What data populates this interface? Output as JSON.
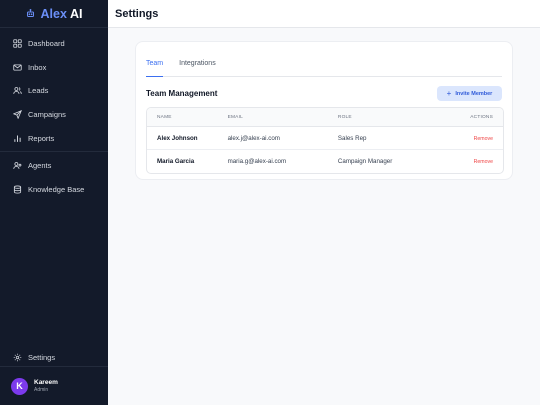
{
  "brand": {
    "name_part1": "Alex",
    "name_part2": "AI",
    "icon": "robot-icon",
    "accent": "#6b8ff7"
  },
  "sidebar": {
    "items": [
      {
        "label": "Dashboard",
        "icon": "dashboard-grid-icon"
      },
      {
        "label": "Inbox",
        "icon": "mail-icon"
      },
      {
        "label": "Leads",
        "icon": "users-icon"
      },
      {
        "label": "Campaigns",
        "icon": "send-icon"
      },
      {
        "label": "Reports",
        "icon": "bar-chart-icon"
      },
      {
        "label": "Agents",
        "icon": "agent-icon"
      },
      {
        "label": "Knowledge Base",
        "icon": "database-icon"
      }
    ],
    "settings": {
      "label": "Settings",
      "icon": "gear-icon"
    },
    "user": {
      "initial": "K",
      "name": "Kareem",
      "role": "Admin"
    }
  },
  "header": {
    "title": "Settings"
  },
  "tabs": [
    {
      "label": "Team",
      "active": true
    },
    {
      "label": "Integrations",
      "active": false
    }
  ],
  "team": {
    "title": "Team Management",
    "invite_label": "Invite Member",
    "invite_symbol": "+",
    "columns": [
      "NAME",
      "EMAIL",
      "ROLE",
      "ACTIONS"
    ],
    "members": [
      {
        "name": "Alex Johnson",
        "email": "alex.j@alex-ai.com",
        "role": "Sales Rep",
        "action": "Remove"
      },
      {
        "name": "Maria Garcia",
        "email": "maria.g@alex-ai.com",
        "role": "Campaign Manager",
        "action": "Remove"
      }
    ]
  },
  "colors": {
    "sidebar_bg": "#131a2a",
    "primary": "#3b6ff0",
    "danger": "#ef4444",
    "avatar": "#7c3aed"
  }
}
